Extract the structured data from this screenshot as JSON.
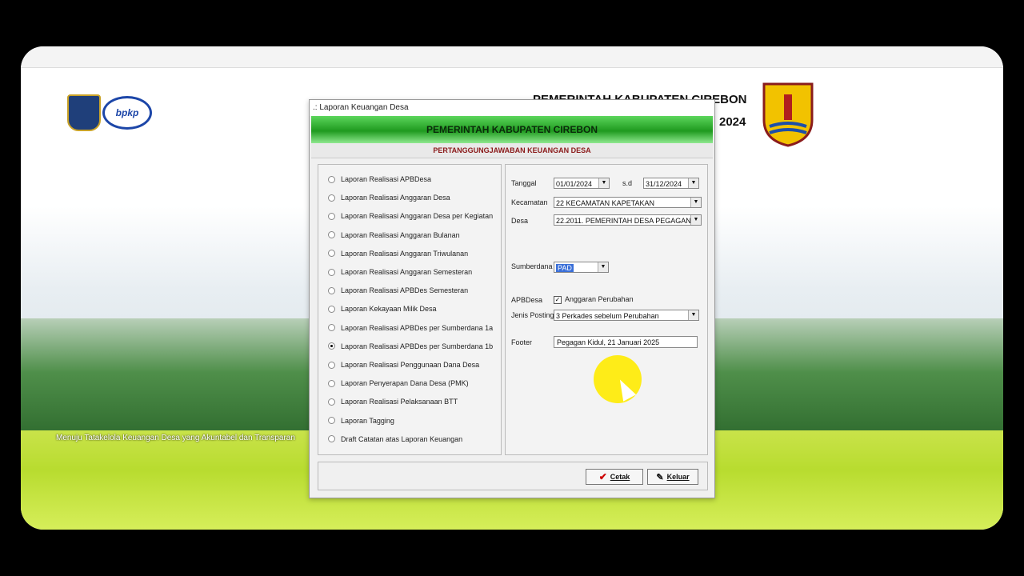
{
  "header": {
    "title": "PEMERINTAH KABUPATEN CIREBON",
    "year": "2024",
    "logo_text": "bpkp",
    "tagline": "Menuju Tatakelola Keuangan Desa yang Akuntabel dan Transparan"
  },
  "dialog": {
    "window_title": ".: Laporan Keuangan Desa",
    "banner": "PEMERINTAH KABUPATEN CIREBON",
    "subtitle": "PERTANGGUNGJAWABAN KEUANGAN DESA",
    "reports": [
      {
        "label": "Laporan Realisasi APBDesa",
        "selected": false
      },
      {
        "label": "Laporan Realisasi Anggaran Desa",
        "selected": false
      },
      {
        "label": "Laporan Realisasi Anggaran Desa per Kegiatan",
        "selected": false
      },
      {
        "label": "Laporan Realisasi Anggaran Bulanan",
        "selected": false
      },
      {
        "label": "Laporan Realisasi Anggaran Triwulanan",
        "selected": false
      },
      {
        "label": "Laporan Realisasi Anggaran Semesteran",
        "selected": false
      },
      {
        "label": "Laporan Realisasi APBDes Semesteran",
        "selected": false
      },
      {
        "label": "Laporan Kekayaan Milik Desa",
        "selected": false
      },
      {
        "label": "Laporan Realisasi APBDes per Sumberdana 1a",
        "selected": false
      },
      {
        "label": "Laporan Realisasi APBDes per Sumberdana 1b",
        "selected": true
      },
      {
        "label": "Laporan Realisasi Penggunaan Dana Desa",
        "selected": false
      },
      {
        "label": "Laporan Penyerapan Dana Desa (PMK)",
        "selected": false
      },
      {
        "label": "Laporan Realisasi Pelaksanaan BTT",
        "selected": false
      },
      {
        "label": "Laporan Tagging",
        "selected": false
      },
      {
        "label": "Draft Catatan atas Laporan Keuangan",
        "selected": false
      }
    ],
    "form": {
      "tanggal_label": "Tanggal",
      "tanggal_from": "01/01/2024",
      "sd_label": "s.d",
      "tanggal_to": "31/12/2024",
      "kecamatan_label": "Kecamatan",
      "kecamatan_value": "22  KECAMATAN KAPETAKAN",
      "desa_label": "Desa",
      "desa_value": "22.2011.  PEMERINTAH DESA PEGAGAN",
      "sumberdana_label": "Sumberdana",
      "sumberdana_value": "PAD",
      "apbdesa_label": "APBDesa",
      "anggaran_perubahan_label": "Anggaran Perubahan",
      "anggaran_perubahan_checked": true,
      "jenis_posting_label": "Jenis Posting",
      "jenis_posting_value": "3  Perkades sebelum Perubahan",
      "footer_label": "Footer",
      "footer_value": "Pegagan Kidul,  21 Januari 2025"
    },
    "buttons": {
      "cetak": "Cetak",
      "keluar": "Keluar"
    }
  }
}
